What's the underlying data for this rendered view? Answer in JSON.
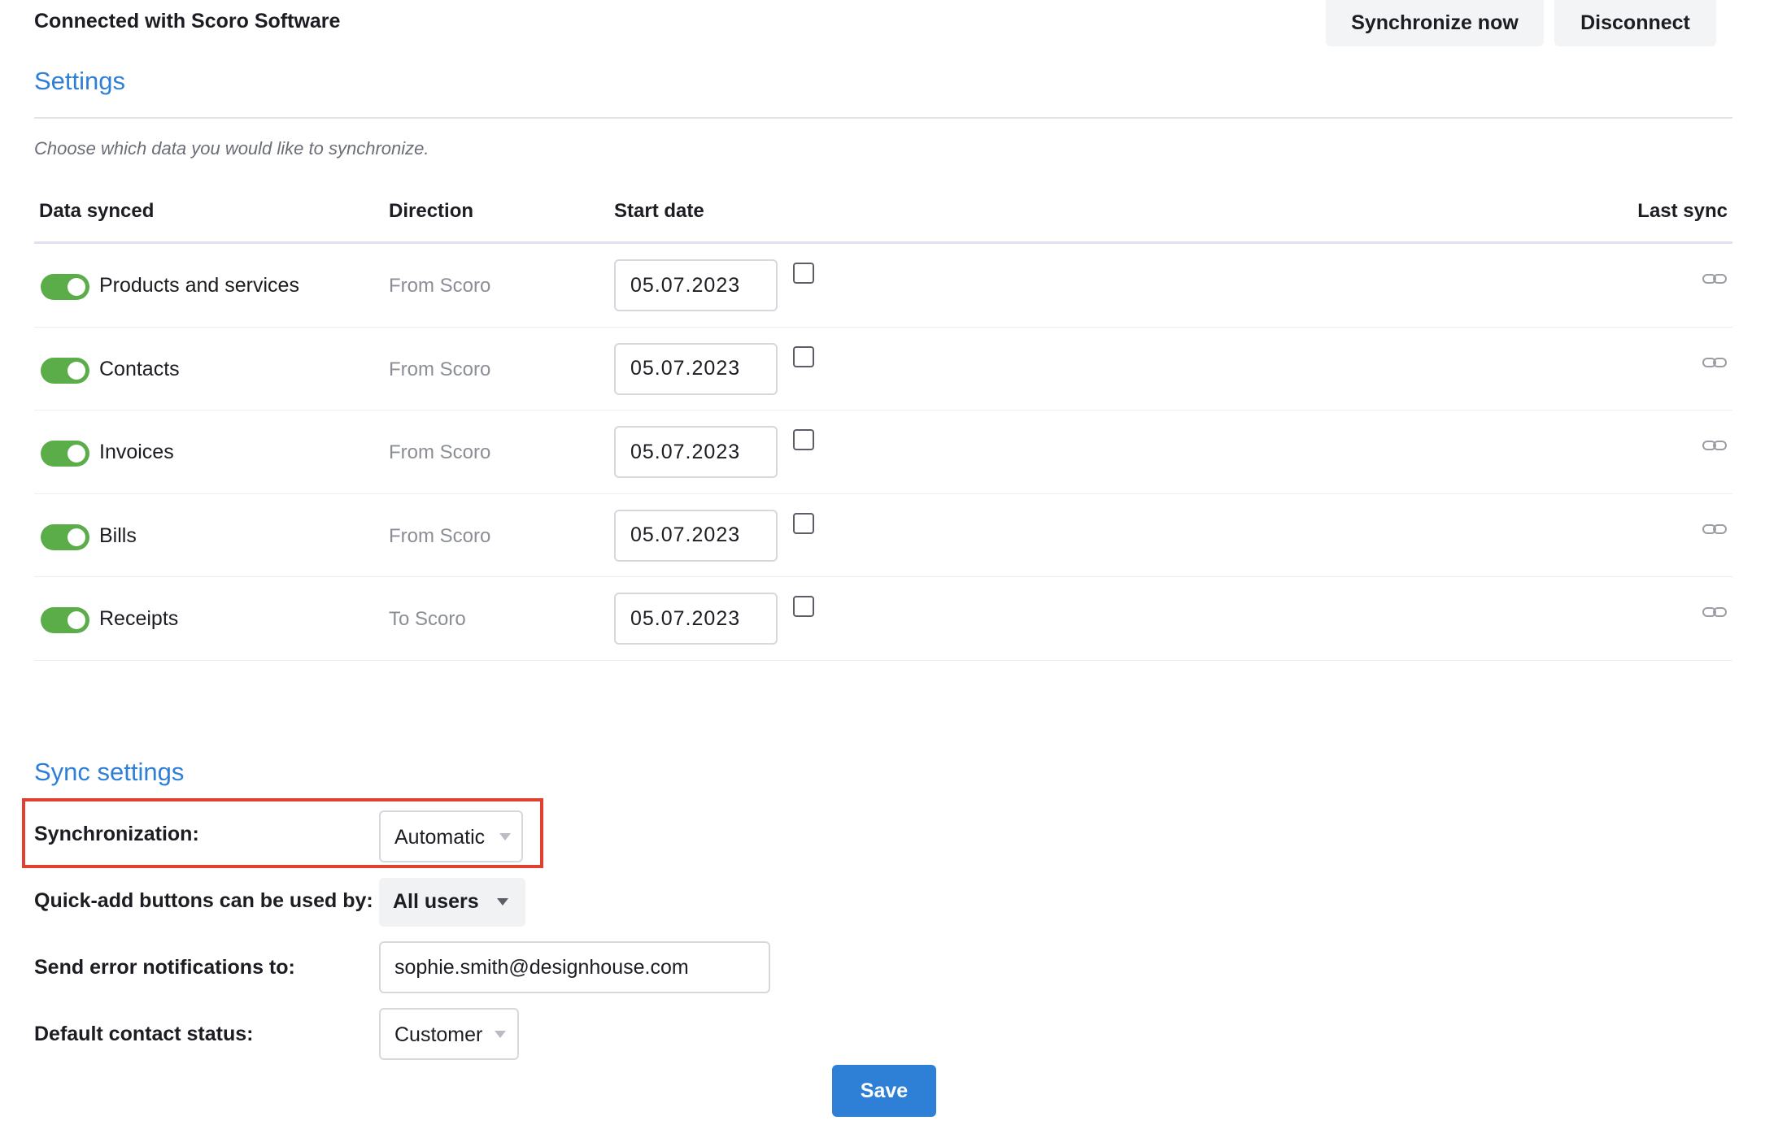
{
  "header": {
    "title": "Connected with Scoro Software",
    "sync_now_label": "Synchronize now",
    "disconnect_label": "Disconnect"
  },
  "settings": {
    "title": "Settings",
    "hint": "Choose which data you would like to synchronize.",
    "columns": {
      "data_synced": "Data synced",
      "direction": "Direction",
      "start_date": "Start date",
      "last_sync": "Last sync"
    },
    "rows": [
      {
        "label": "Products and services",
        "direction": "From Scoro",
        "start_date": "05.07.2023",
        "enabled": true,
        "checked": false
      },
      {
        "label": "Contacts",
        "direction": "From Scoro",
        "start_date": "05.07.2023",
        "enabled": true,
        "checked": false
      },
      {
        "label": "Invoices",
        "direction": "From Scoro",
        "start_date": "05.07.2023",
        "enabled": true,
        "checked": false
      },
      {
        "label": "Bills",
        "direction": "From Scoro",
        "start_date": "05.07.2023",
        "enabled": true,
        "checked": false
      },
      {
        "label": "Receipts",
        "direction": "To Scoro",
        "start_date": "05.07.2023",
        "enabled": true,
        "checked": false
      }
    ],
    "last_sync_icon": "link-icon"
  },
  "sync_settings": {
    "title": "Sync settings",
    "synchronization_label": "Synchronization:",
    "synchronization_value": "Automatic",
    "quick_add_label": "Quick-add buttons can be used by:",
    "quick_add_value": "All users",
    "error_notify_label": "Send error notifications to:",
    "error_notify_value": "sophie.smith@designhouse.com",
    "contact_status_label": "Default contact status:",
    "contact_status_value": "Customer"
  },
  "save_label": "Save",
  "colors": {
    "accent": "#2e7fd6",
    "toggle_on": "#5aad48",
    "highlight": "#e2402f"
  }
}
